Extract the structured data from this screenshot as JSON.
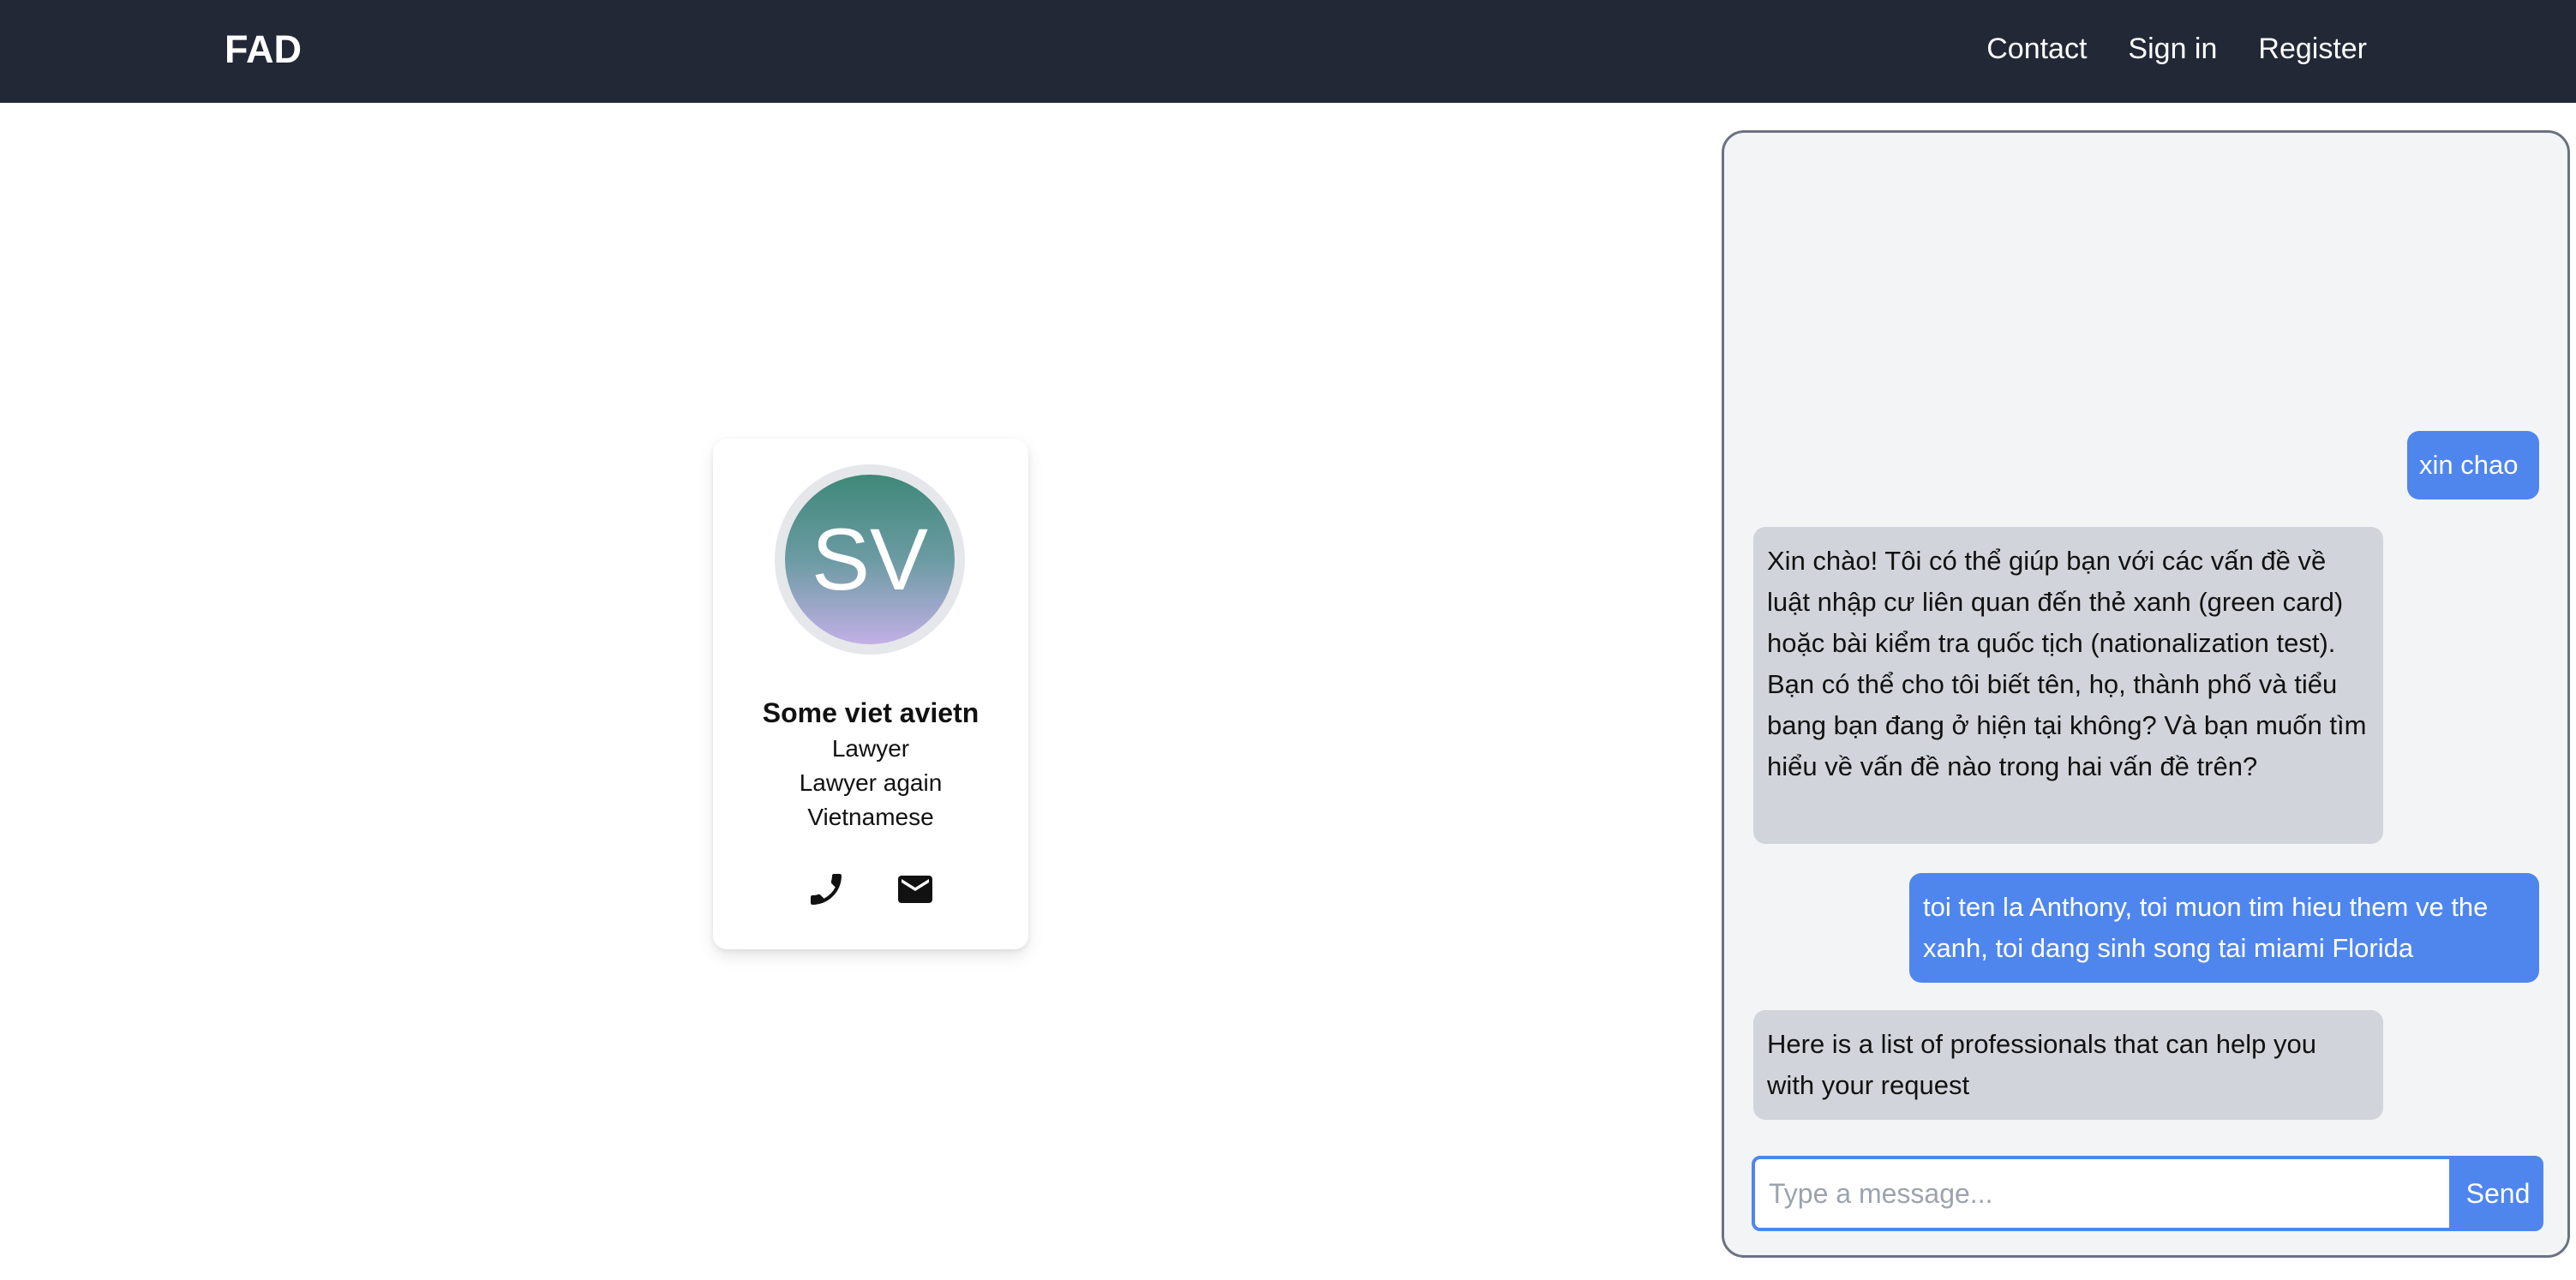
{
  "navbar": {
    "brand": "FAD",
    "links": [
      "Contact",
      "Sign in",
      "Register"
    ],
    "background": "#222836"
  },
  "profile_card": {
    "initials": "SV",
    "name": "Some viet avietn",
    "title": "Lawyer",
    "subtitle": "Lawyer again",
    "language": "Vietnamese",
    "icons": [
      "phone-icon",
      "mail-icon"
    ]
  },
  "chat": {
    "messages": [
      {
        "role": "user",
        "text": "xin chao"
      },
      {
        "role": "assistant",
        "text": "Xin chào! Tôi có thể giúp bạn với các vấn đề về luật nhập cư liên quan đến thẻ xanh (green card) hoặc bài kiểm tra quốc tịch (nationalization test). Bạn có thể cho tôi biết tên, họ, thành phố và tiểu bang bạn đang ở hiện tại không? Và bạn muốn tìm hiểu về vấn đề nào trong hai vấn đề trên?"
      },
      {
        "role": "user",
        "text": "toi ten la Anthony, toi muon tim hieu them ve the xanh, toi dang sinh song tai miami Florida"
      },
      {
        "role": "assistant",
        "text": "Here is a list of professionals that can help you with your request"
      }
    ],
    "input": {
      "value": "",
      "placeholder": "Type a message..."
    },
    "send_label": "Send",
    "accent": "#4f86ee"
  }
}
